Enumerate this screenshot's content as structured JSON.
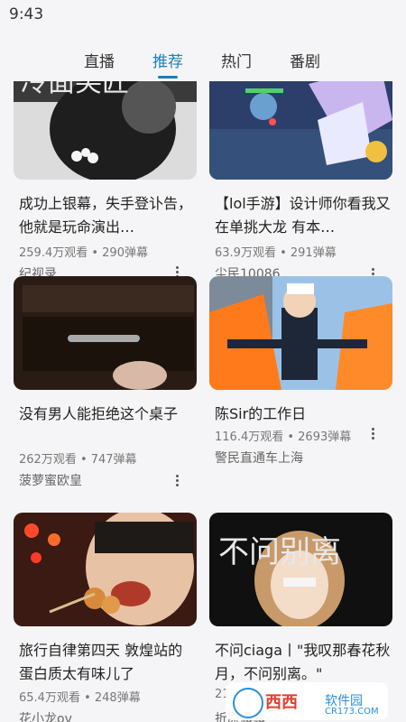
{
  "status_bar": {
    "time": "9:43"
  },
  "tabs": [
    {
      "label": "直播",
      "active": false
    },
    {
      "label": "推荐",
      "active": true
    },
    {
      "label": "热门",
      "active": false
    },
    {
      "label": "番剧",
      "active": false
    }
  ],
  "accent_color": "#1a7fb7",
  "videos": [
    {
      "title": "成功上银幕，失手登讣告，他就是玩命演出…",
      "stats": "259.4万观看 • 290弹幕",
      "author": "纪视录",
      "thumb_words": "冷面笑匠"
    },
    {
      "title": "【lol手游】设计师你看我又在单挑大龙 有本…",
      "stats": "63.9万观看 • 291弹幕",
      "author": "尘民10086"
    },
    {
      "title": "没有男人能拒绝这个桌子",
      "stats": "262万观看 • 747弹幕",
      "author": "菠萝蜜欧皇"
    },
    {
      "title": "陈Sir的工作日",
      "stats": "116.4万观看 • 2693弹幕",
      "author": "警民直通车上海"
    },
    {
      "title": "旅行自律第四天 敦煌站的蛋白质太有味儿了",
      "stats": "65.4万观看 • 248弹幕",
      "author": "花小龙ov"
    },
    {
      "title": "不问ciaga丨\"我叹那春花秋月，不问别离。\"",
      "stats": "21",
      "author": "折原露露",
      "thumb_words": "不问别离"
    }
  ],
  "watermark": {
    "brand": "西西",
    "site": "软件园",
    "domain": "CR173.COM"
  }
}
